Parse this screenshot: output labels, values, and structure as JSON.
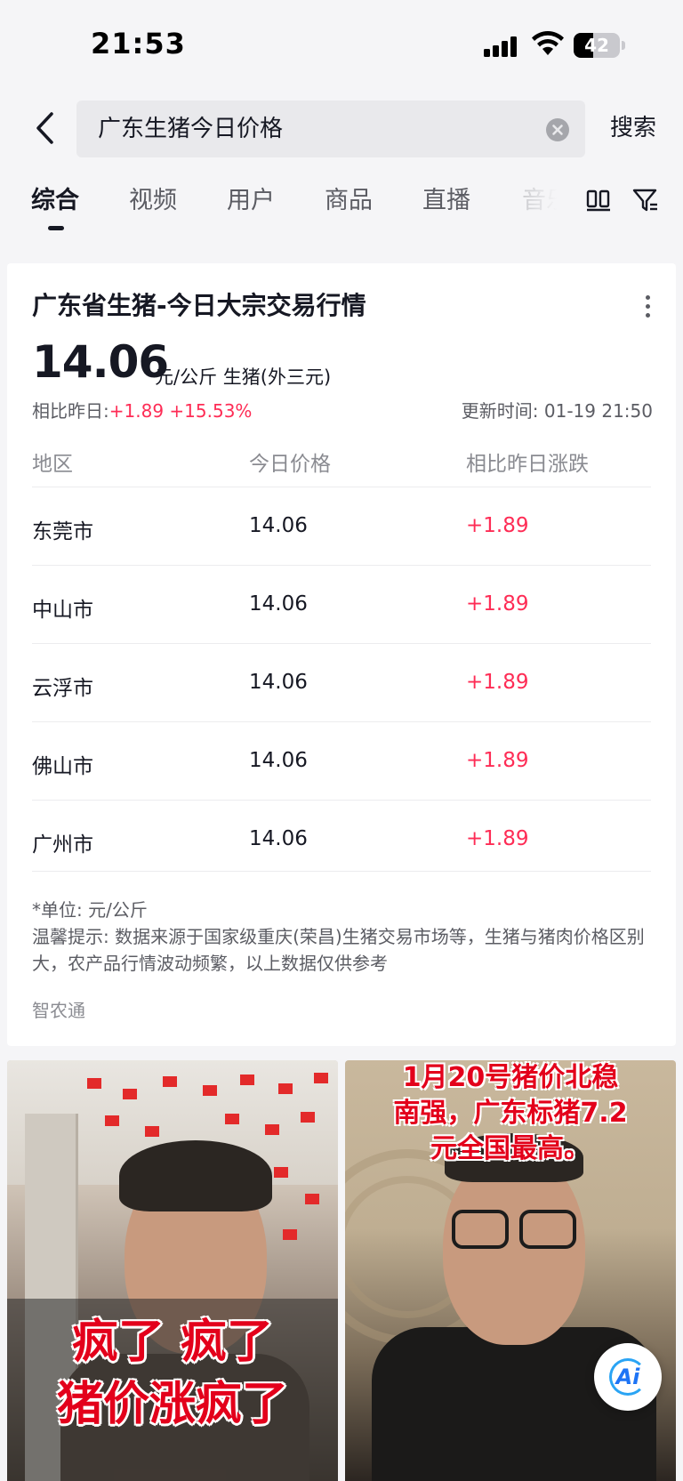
{
  "status_bar": {
    "time": "21:53",
    "battery": "42",
    "battery_level": 0.42
  },
  "search": {
    "query": "广东生猪今日价格",
    "button_label": "搜索"
  },
  "tabs": [
    {
      "label": "综合",
      "active": true
    },
    {
      "label": "视频"
    },
    {
      "label": "用户"
    },
    {
      "label": "商品"
    },
    {
      "label": "直播"
    },
    {
      "label": "音乐"
    }
  ],
  "card": {
    "title": "广东省生猪-今日大宗交易行情",
    "price": "14.06",
    "price_unit": "元/公斤  生猪(外三元)",
    "change_label": "相比昨日:",
    "change_value": "+1.89",
    "change_percent": "+15.53%",
    "update_time": "更新时间:  01-19 21:50",
    "table_headers": [
      "地区",
      "今日价格",
      "相比昨日涨跌"
    ],
    "rows": [
      {
        "region": "东莞市",
        "price": "14.06",
        "change": "+1.89"
      },
      {
        "region": "中山市",
        "price": "14.06",
        "change": "+1.89"
      },
      {
        "region": "云浮市",
        "price": "14.06",
        "change": "+1.89"
      },
      {
        "region": "佛山市",
        "price": "14.06",
        "change": "+1.89"
      },
      {
        "region": "广州市",
        "price": "14.06",
        "change": "+1.89"
      }
    ],
    "unit_note": "*单位:  元/公斤",
    "tip": "温馨提示:  数据来源于国家级重庆(荣昌)生猪交易市场等，生猪与猪肉价格区别大，农产品行情波动频繁，以上数据仅供参考",
    "source": "智农通"
  },
  "videos": [
    {
      "caption_line1": "疯了 疯了",
      "caption_line2": "猪价涨疯了"
    },
    {
      "caption_line1": "1月20号猪价北稳",
      "caption_line2": "南强，广东标猪7.2",
      "caption_line3": "元全国最高。"
    }
  ],
  "ai_button": {
    "label": "Ai"
  }
}
